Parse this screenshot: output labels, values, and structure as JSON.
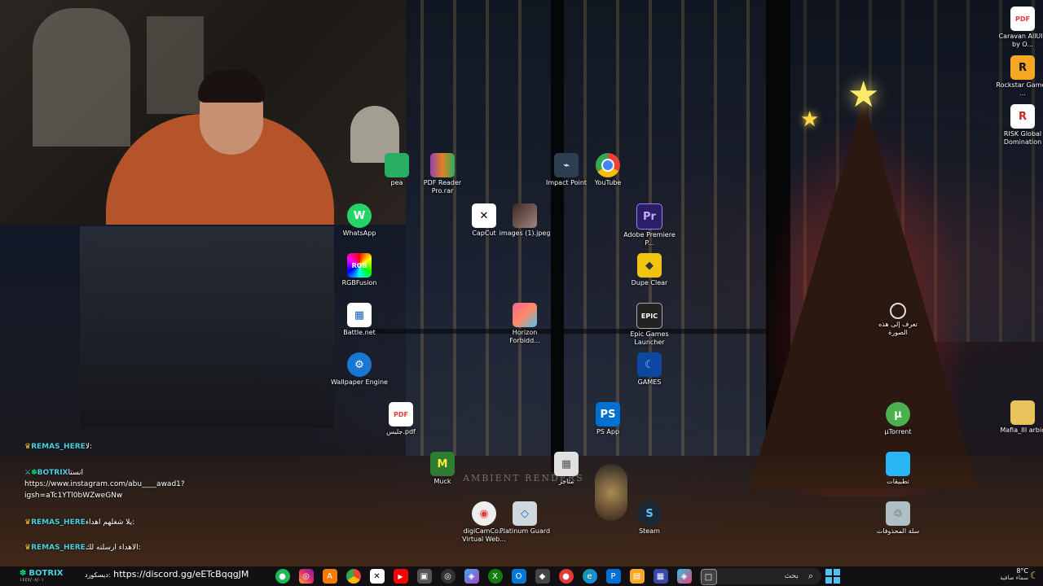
{
  "desktop": {
    "icons_right": [
      {
        "id": "caravan",
        "label": "Caravan AllUla by O...",
        "glyph": "PDF",
        "color": "#e53935"
      },
      {
        "id": "rockstar",
        "label": "Rockstar Games ...",
        "glyph": "R",
        "color": "#f5a623"
      },
      {
        "id": "risk",
        "label": "RISK Global Domination",
        "glyph": "R",
        "color": "#c62828"
      },
      {
        "id": "mafia",
        "label": "Mafia_III arbic",
        "glyph": "■",
        "color": "#e8c25a"
      }
    ],
    "icons_center": [
      {
        "id": "pea",
        "label": "pea",
        "glyph": "■",
        "color": "#27ae60"
      },
      {
        "id": "pdf-reader",
        "label": "PDF Reader Pro.rar",
        "glyph": "▤",
        "color": "#8e44ad"
      },
      {
        "id": "impact-point",
        "label": "Impact Point",
        "glyph": "⌁",
        "color": "#2c3e50"
      },
      {
        "id": "youtube-chrome",
        "label": "YouTube",
        "glyph": "●",
        "color": "#1e88e5"
      },
      {
        "id": "whatsapp",
        "label": "WhatsApp",
        "glyph": "W",
        "color": "#25d366"
      },
      {
        "id": "capcut",
        "label": "CapCut",
        "glyph": "✕",
        "color": "#111111"
      },
      {
        "id": "images",
        "label": "images (1).jpeg",
        "glyph": "▣",
        "color": "#5d4037"
      },
      {
        "id": "premiere",
        "label": "Adobe Premiere P...",
        "glyph": "Pr",
        "color": "#2a1f66"
      },
      {
        "id": "rgbfusion",
        "label": "RGBFusion",
        "glyph": "RGB",
        "color": "#444"
      },
      {
        "id": "dupe-clear",
        "label": "Dupe Clear",
        "glyph": "◆",
        "color": "#f1c40f"
      },
      {
        "id": "battlenet",
        "label": "Battle.net",
        "glyph": "▦",
        "color": "#1565c0"
      },
      {
        "id": "horizon",
        "label": "Horizon Forbidd...",
        "glyph": "H",
        "color": "#d35400"
      },
      {
        "id": "epic",
        "label": "Epic Games Launcher",
        "glyph": "EPIC",
        "color": "#222"
      },
      {
        "id": "wallpaper-engine",
        "label": "Wallpaper Engine",
        "glyph": "⚙",
        "color": "#1976d2"
      },
      {
        "id": "games",
        "label": "GAMES",
        "glyph": "☾",
        "color": "#1e88e5"
      },
      {
        "id": "jalis-pdf",
        "label": "جليس.pdf",
        "glyph": "PDF",
        "color": "#e53935"
      },
      {
        "id": "ps-app",
        "label": "PS App",
        "glyph": "PS",
        "color": "#0070d1"
      },
      {
        "id": "utorrent",
        "label": "µTorrent",
        "glyph": "µ",
        "color": "#4caf50"
      },
      {
        "id": "muck",
        "label": "Muck",
        "glyph": "M",
        "color": "#2e7d32"
      },
      {
        "id": "store",
        "label": "متاجر",
        "glyph": "▦",
        "color": "#9e9e9e"
      },
      {
        "id": "apps",
        "label": "تطبيقات",
        "glyph": "▮",
        "color": "#29b6f6"
      },
      {
        "id": "digicam",
        "label": "digiCamCo... Virtual Web...",
        "glyph": "◉",
        "color": "#bdbdbd"
      },
      {
        "id": "platinum",
        "label": "Platinum Guard",
        "glyph": "◇",
        "color": "#90caf9"
      },
      {
        "id": "steam",
        "label": "Steam",
        "glyph": "S",
        "color": "#1b2838"
      },
      {
        "id": "recycle",
        "label": "سلة المحذوفات",
        "glyph": "♲",
        "color": "#78909c"
      },
      {
        "id": "learn-more",
        "label": "تعرف إلى هذه الصورة",
        "glyph": "⚉",
        "color": "#555"
      }
    ],
    "watermark": "AMBIENT RENDERS"
  },
  "chat": {
    "messages": [
      {
        "user": "REMAS_HERE",
        "text": "لا:"
      },
      {
        "user": "BOTRIX",
        "text": "انستا"
      },
      {
        "user": "REMAS_HERE",
        "text": "يلا شغلهم اهداء:"
      },
      {
        "user": "REMAS_HERE",
        "text": "الاهداء ارسلته لك:"
      }
    ],
    "instagram_link": "https://www.instagram.com/abu____awad1?",
    "instagram_link2": "igsh=aTc1YTl0bWZweGNw",
    "discord_link": "https://discord.gg/eETcBqqgJM",
    "discord_text": "ديسكورد:"
  },
  "taskbar": {
    "search_placeholder": "بحث",
    "clock_label": "BOTRIX",
    "date": "١٤٤٧/٠٨/٠١",
    "weather_temp": "8°C",
    "weather_desc": "سماء صافية",
    "apps": [
      {
        "id": "spotify",
        "glyph": "●",
        "color": "#1db954"
      },
      {
        "id": "instagram",
        "glyph": "◎",
        "color": "#e1306c"
      },
      {
        "id": "acrobat",
        "glyph": "A",
        "color": "#f57c00"
      },
      {
        "id": "chrome",
        "glyph": "◉",
        "color": "#fbc02d"
      },
      {
        "id": "capcut-tb",
        "glyph": "✕",
        "color": "#222"
      },
      {
        "id": "youtube",
        "glyph": "▶",
        "color": "#ff0000"
      },
      {
        "id": "photos",
        "glyph": "▣",
        "color": "#555"
      },
      {
        "id": "obs",
        "glyph": "◎",
        "color": "#333"
      },
      {
        "id": "copilot",
        "glyph": "◈",
        "color": "#7e57c2"
      },
      {
        "id": "xbox",
        "glyph": "X",
        "color": "#107c10"
      },
      {
        "id": "outlook",
        "glyph": "O",
        "color": "#0078d4"
      },
      {
        "id": "unity",
        "glyph": "◆",
        "color": "#444"
      },
      {
        "id": "rec",
        "glyph": "●",
        "color": "#e53935"
      },
      {
        "id": "edge",
        "glyph": "e",
        "color": "#0f9d9d"
      },
      {
        "id": "ps",
        "glyph": "P",
        "color": "#0070d1"
      },
      {
        "id": "explorer",
        "glyph": "▤",
        "color": "#f9a825"
      },
      {
        "id": "store-tb",
        "glyph": "▦",
        "color": "#3949ab"
      },
      {
        "id": "copilot2",
        "glyph": "◈",
        "color": "#42a5f5"
      },
      {
        "id": "terminal",
        "glyph": "□",
        "color": "#333"
      }
    ]
  }
}
